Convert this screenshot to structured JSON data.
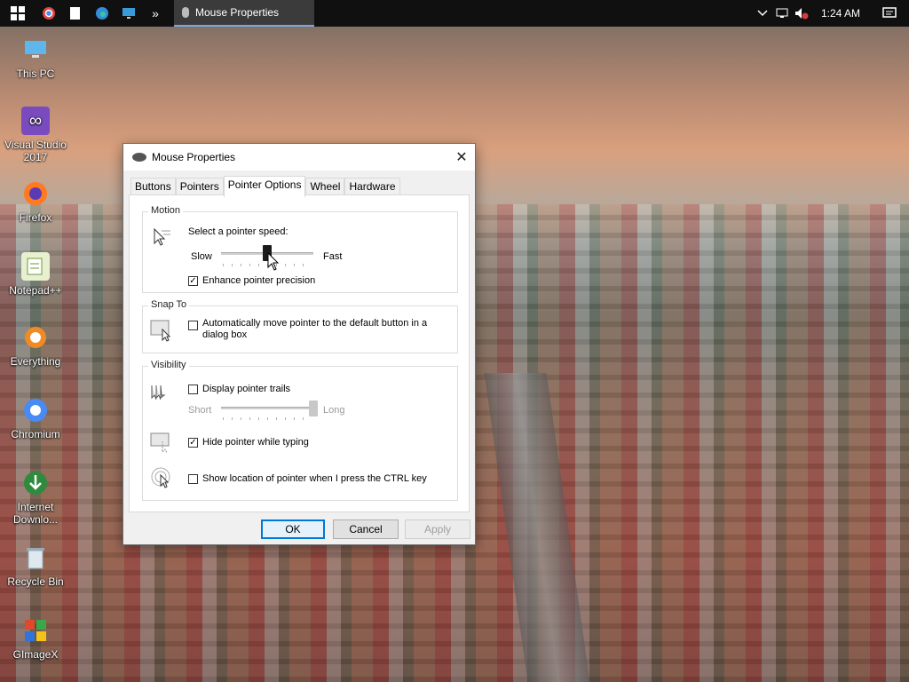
{
  "taskbar": {
    "active_window": "Mouse Properties",
    "clock": "1:24 AM",
    "start_icon": "windows-logo",
    "pinned": [
      "chrome-icon",
      "file-icon",
      "edge-icon",
      "monitor-icon"
    ],
    "overflow": "»"
  },
  "desktop": {
    "icons": [
      {
        "label": "This PC",
        "icon": "computer-icon"
      },
      {
        "label": "Visual Studio 2017",
        "icon": "visual-studio-icon"
      },
      {
        "label": "Firefox",
        "icon": "firefox-icon"
      },
      {
        "label": "Notepad++",
        "icon": "notepad-icon"
      },
      {
        "label": "Everything",
        "icon": "search-icon"
      },
      {
        "label": "Chromium",
        "icon": "chromium-icon"
      },
      {
        "label": "Internet Downlo...",
        "icon": "download-icon"
      },
      {
        "label": "Recycle Bin",
        "icon": "recycle-bin-icon"
      },
      {
        "label": "GImageX",
        "icon": "gimagex-icon"
      }
    ]
  },
  "dialog": {
    "title": "Mouse Properties",
    "tabs": [
      "Buttons",
      "Pointers",
      "Pointer Options",
      "Wheel",
      "Hardware"
    ],
    "active_tab": "Pointer Options",
    "motion": {
      "label": "Motion",
      "prompt": "Select a pointer speed:",
      "slow": "Slow",
      "fast": "Fast",
      "speed_fraction": 0.5,
      "enhance_label": "Enhance pointer precision",
      "enhance_checked": true
    },
    "snap": {
      "label": "Snap To",
      "text": "Automatically move pointer to the default button in a dialog box",
      "checked": false
    },
    "visibility": {
      "label": "Visibility",
      "trails_label": "Display pointer trails",
      "trails_checked": false,
      "short": "Short",
      "long": "Long",
      "trail_fraction": 1.0,
      "hide_label": "Hide pointer while typing",
      "hide_checked": true,
      "ctrl_label": "Show location of pointer when I press the CTRL key",
      "ctrl_checked": false
    },
    "buttons": {
      "ok": "OK",
      "cancel": "Cancel",
      "apply": "Apply"
    }
  }
}
